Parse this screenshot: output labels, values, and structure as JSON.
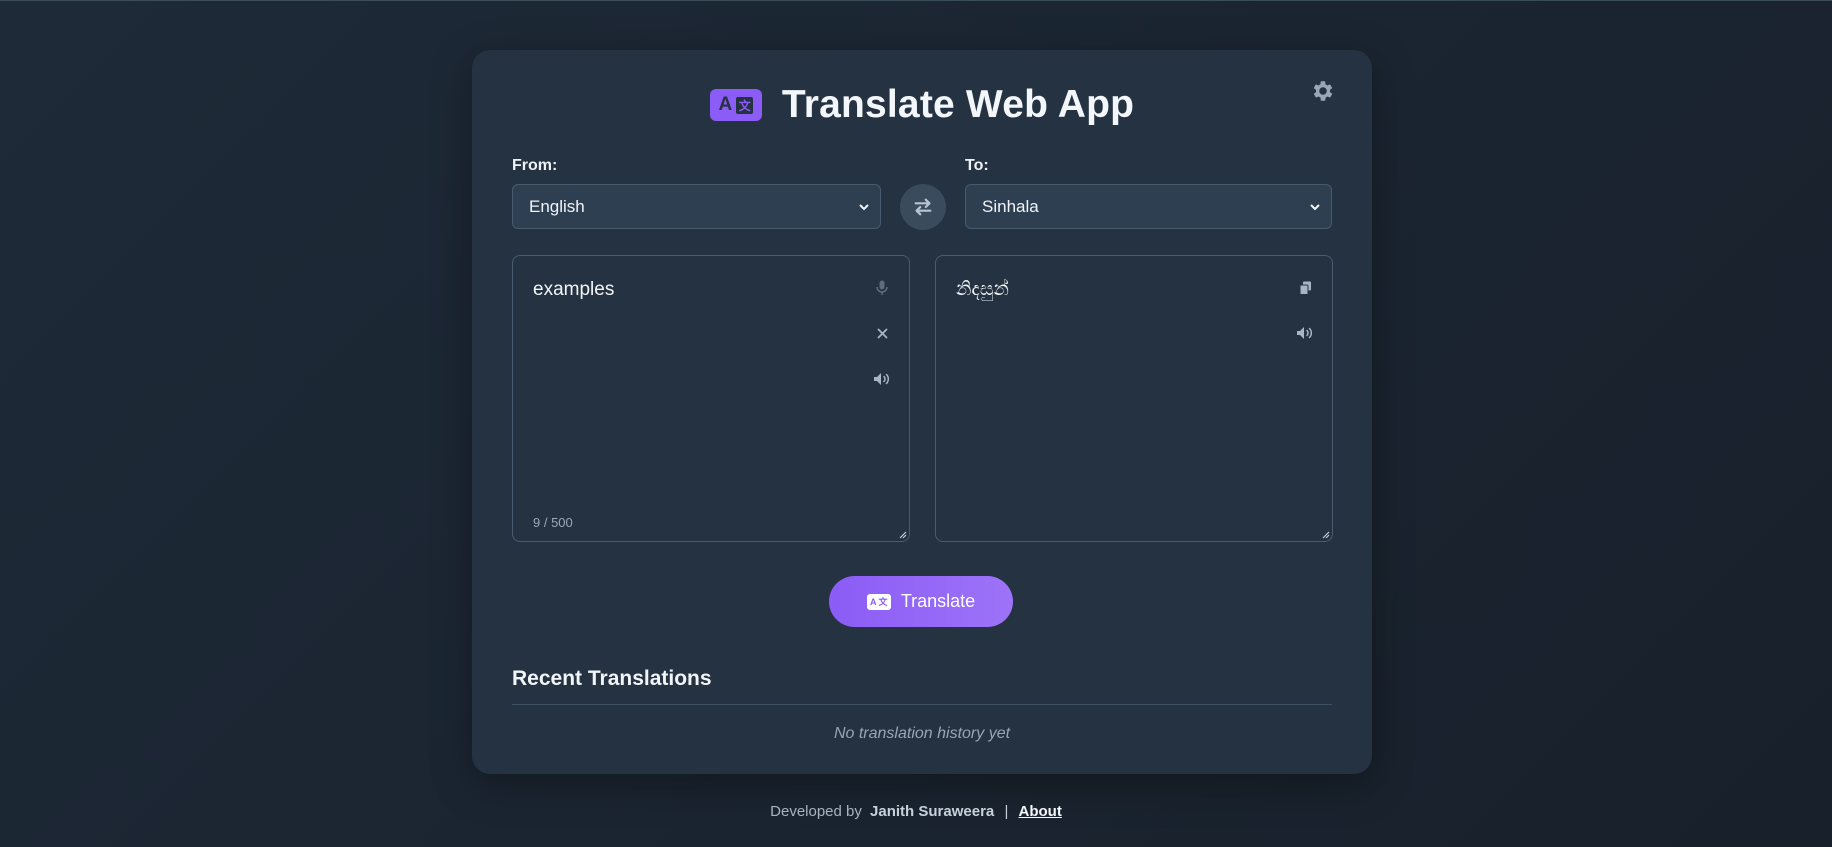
{
  "app": {
    "title": "Translate Web App"
  },
  "icons": {
    "logo": "translate-icon",
    "settings": "gear-icon",
    "swap": "swap-arrows-icon",
    "mic": "microphone-icon",
    "clear": "close-icon",
    "speak": "speaker-icon",
    "copy": "copy-icon"
  },
  "colors": {
    "accent": "#8b5cf6",
    "card": "#243241",
    "background": "#1b2531"
  },
  "from": {
    "label": "From:",
    "selected": "English"
  },
  "to": {
    "label": "To:",
    "selected": "Sinhala"
  },
  "input": {
    "text": "examples",
    "counter": "9 / 500"
  },
  "output": {
    "text": "නිදසුන්"
  },
  "translate_button": {
    "label": "Translate"
  },
  "recent": {
    "title": "Recent Translations",
    "empty_message": "No translation history yet"
  },
  "footer": {
    "prefix": "Developed by",
    "author": "Janith Suraweera",
    "separator": "|",
    "about": "About"
  }
}
